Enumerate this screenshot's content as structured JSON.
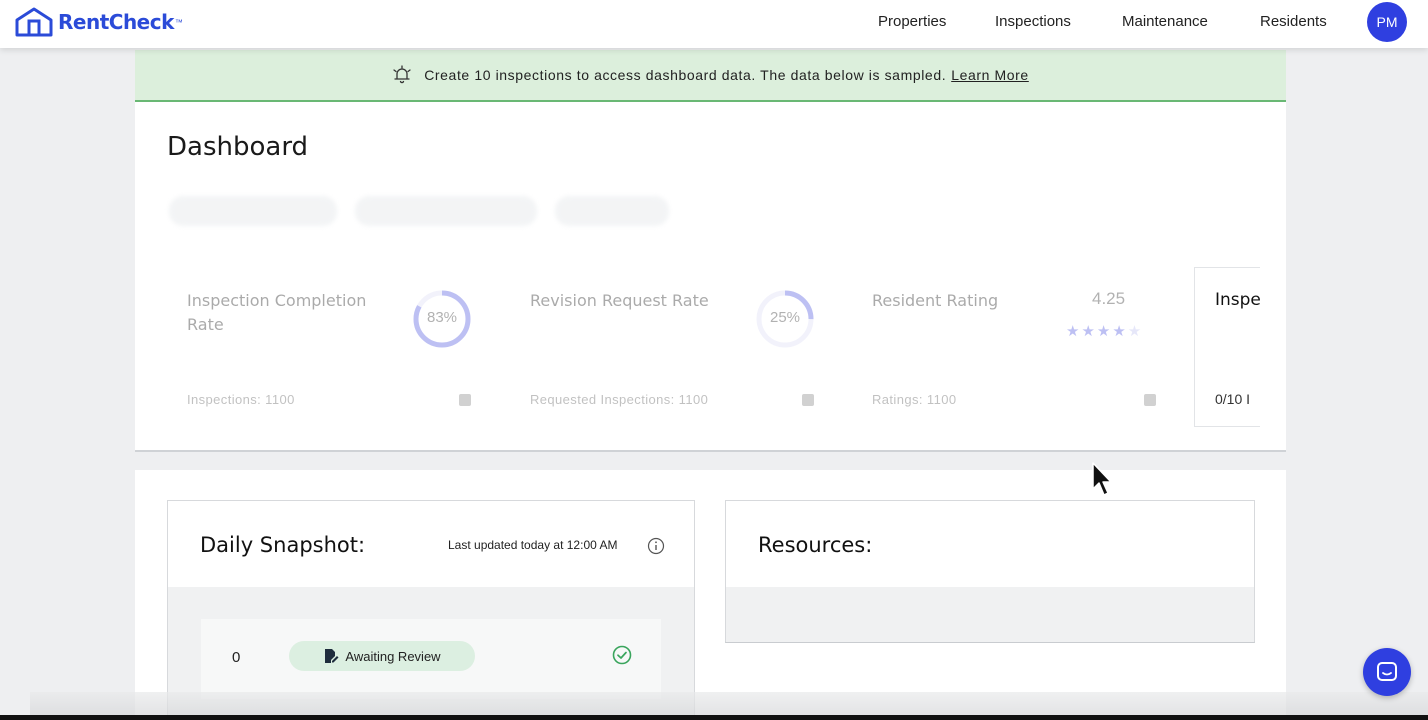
{
  "header": {
    "logo_text": "RentCheck",
    "logo_tm": "™",
    "nav": [
      "Properties",
      "Inspections",
      "Maintenance",
      "Residents"
    ],
    "avatar_initials": "PM"
  },
  "banner": {
    "message": "Create 10 inspections to access dashboard data. The data below is sampled.",
    "link": "Learn More",
    "icon": "bell-icon"
  },
  "dashboard": {
    "title": "Dashboard",
    "metrics": [
      {
        "label": "Inspection Completion Rate",
        "value": "83%",
        "percent": 83,
        "sub": "Inspections: 1100"
      },
      {
        "label": "Revision Request Rate",
        "value": "25%",
        "percent": 25,
        "sub": "Requested Inspections: 1100"
      },
      {
        "label": "Resident Rating",
        "value": "4.25",
        "stars": 4.25,
        "sub": "Ratings: 1100"
      }
    ],
    "inspections_card": {
      "title": "Inspe",
      "value": "0/10 I"
    }
  },
  "snapshot": {
    "title": "Daily Snapshot:",
    "updated": "Last updated today at 12:00 AM",
    "row": {
      "count": "0",
      "status": "Awaiting Review"
    }
  },
  "resources": {
    "title": "Resources:"
  },
  "colors": {
    "brand": "#2b4bd8",
    "accent": "#2f3fe0",
    "banner_bg": "#dcefdc",
    "banner_border": "#69b874"
  }
}
